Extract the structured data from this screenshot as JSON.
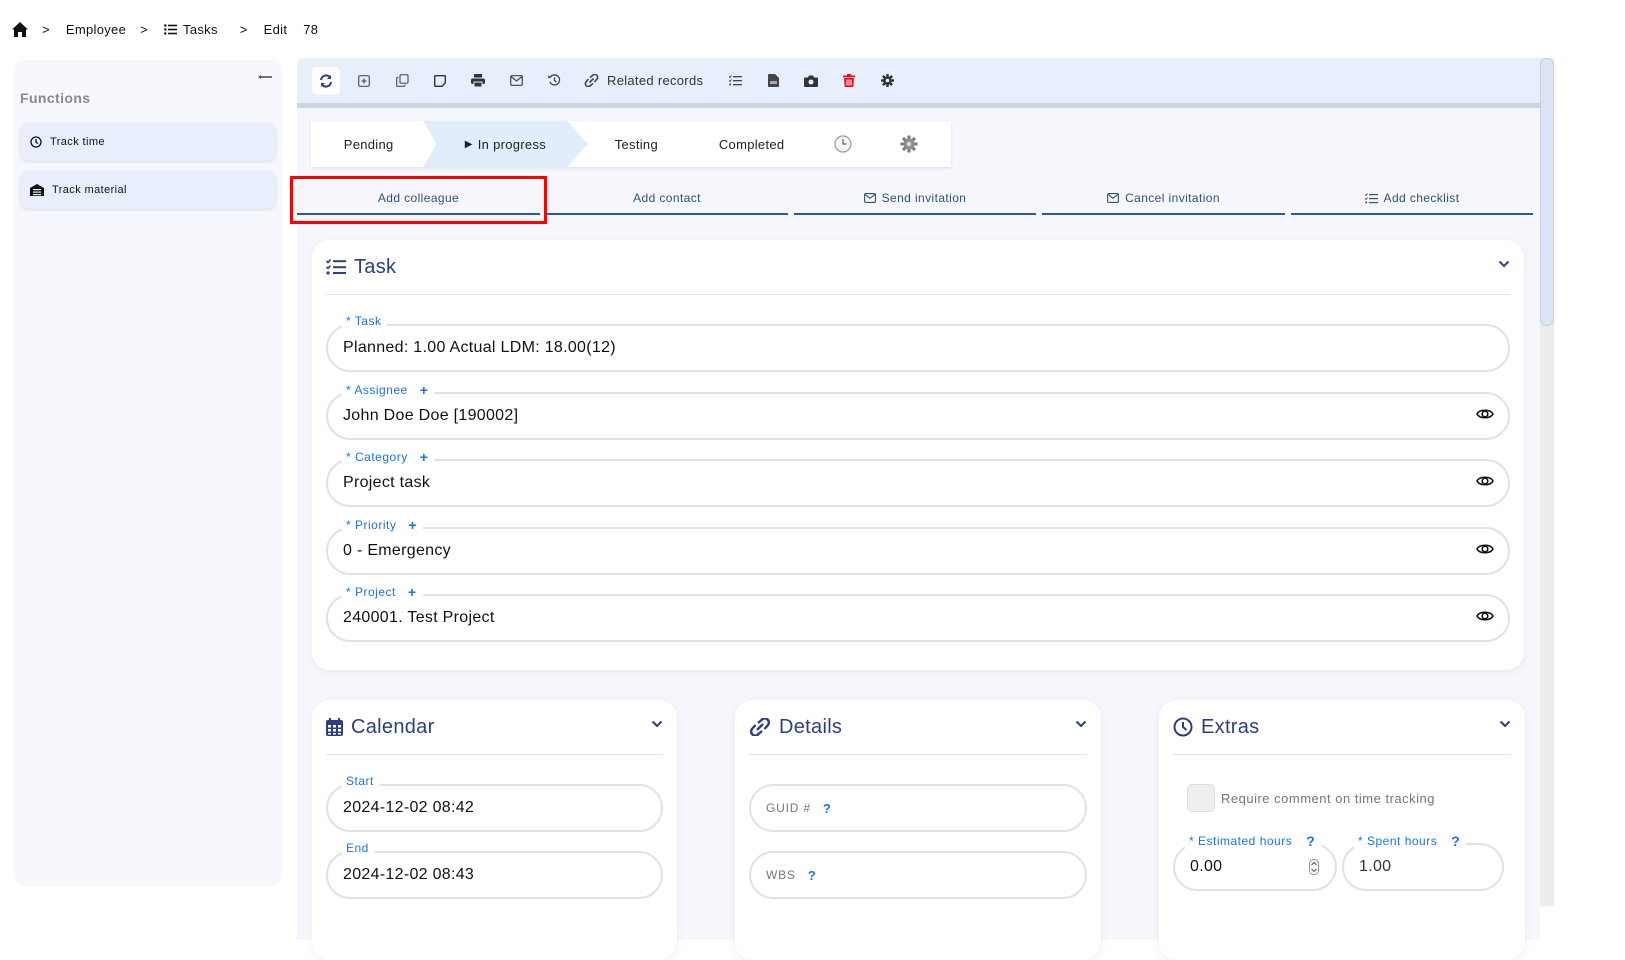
{
  "breadcrumb": {
    "home_icon": "home-icon",
    "items": [
      "Employee",
      "Tasks",
      "Edit"
    ],
    "record_id": "78"
  },
  "sidebar": {
    "title": "Functions",
    "collapse_icon": "collapse-left-icon",
    "items": [
      {
        "label": "Track time",
        "icon": "clock-icon"
      },
      {
        "label": "Track material",
        "icon": "warehouse-icon"
      }
    ]
  },
  "toolbar": {
    "buttons": [
      "refresh",
      "add",
      "copy",
      "note",
      "print",
      "email",
      "history",
      "related-records",
      "checklist",
      "pdf",
      "camera",
      "delete",
      "settings"
    ],
    "related_records_label": "Related records",
    "delete_color": "#e8101b"
  },
  "status_steps": {
    "items": [
      "Pending",
      "In progress",
      "Testing",
      "Completed"
    ],
    "active": "In progress",
    "active_marker": "▶"
  },
  "actions": {
    "items": [
      {
        "label": "Add colleague",
        "icon": null,
        "highlighted": true
      },
      {
        "label": "Add contact",
        "icon": null
      },
      {
        "label": "Send invitation",
        "icon": "envelope-icon"
      },
      {
        "label": "Cancel invitation",
        "icon": "envelope-icon"
      },
      {
        "label": "Add checklist",
        "icon": "checklist-icon"
      }
    ]
  },
  "task_card": {
    "title": "Task",
    "fields": [
      {
        "label": "* Task",
        "value": "Planned: 1.00 Actual LDM: 18.00(12)",
        "plus": false,
        "eye": false
      },
      {
        "label": "* Assignee",
        "value": "John Doe Doe [190002]",
        "plus": true,
        "eye": true
      },
      {
        "label": "* Category",
        "value": "Project task",
        "plus": true,
        "eye": true
      },
      {
        "label": "* Priority",
        "value": "0 - Emergency",
        "plus": true,
        "eye": true
      },
      {
        "label": "* Project",
        "value": "240001. Test Project",
        "plus": true,
        "eye": true
      }
    ],
    "plus_symbol": "+"
  },
  "calendar_card": {
    "title": "Calendar",
    "fields": [
      {
        "label": "Start",
        "value": "2024-12-02 08:42"
      },
      {
        "label": "End",
        "value": "2024-12-02 08:43"
      }
    ]
  },
  "details_card": {
    "title": "Details",
    "fields": [
      {
        "placeholder": "GUID #",
        "help": "?"
      },
      {
        "placeholder": "WBS",
        "help": "?"
      }
    ]
  },
  "extras_card": {
    "title": "Extras",
    "checkbox_label": "Require comment on time tracking",
    "checkbox_checked": false,
    "estimated_hours": {
      "label": "* Estimated hours",
      "help": "?",
      "value": "0.00"
    },
    "spent_hours": {
      "label": "* Spent hours",
      "help": "?",
      "value": "1.00"
    }
  },
  "colors": {
    "accent_blue": "#1a73e8",
    "heading_navy": "#2c3f80",
    "tab_underline": "#2d5a8c",
    "highlight_red": "#ff0000"
  }
}
